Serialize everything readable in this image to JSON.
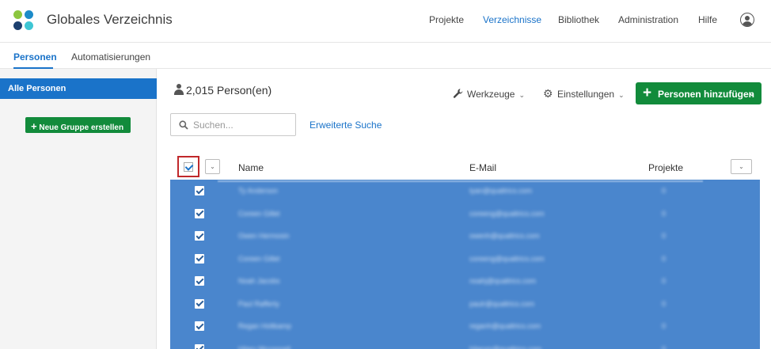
{
  "header": {
    "app_title": "Globales Verzeichnis",
    "nav": [
      {
        "label": "Projekte",
        "active": false
      },
      {
        "label": "Verzeichnisse",
        "active": true
      },
      {
        "label": "Bibliothek",
        "active": false
      },
      {
        "label": "Administration",
        "active": false
      },
      {
        "label": "Hilfe",
        "active": false
      }
    ],
    "profile_icon": "user-circle-icon"
  },
  "subnav": {
    "tabs": [
      {
        "label": "Personen",
        "active": true
      },
      {
        "label": "Automatisierungen",
        "active": false
      }
    ]
  },
  "sidebar": {
    "items": [
      {
        "label": "Alle Personen",
        "active": true
      }
    ],
    "new_group_button": "Neue Gruppe erstellen"
  },
  "main": {
    "count_label": "2,015 Person(en)",
    "tools_label": "Werkzeuge",
    "settings_label": "Einstellungen",
    "add_button_label": "Personen hinzufügen",
    "search": {
      "placeholder": "Suchen...",
      "value": ""
    },
    "advanced_search_label": "Erweiterte Suche"
  },
  "table": {
    "columns": [
      "Name",
      "E-Mail",
      "Projekte"
    ],
    "header_checked": true,
    "rows": [
      {
        "name": "Ty Anderson",
        "email": "tyan@qualtrics.com",
        "projects": "0",
        "checked": true
      },
      {
        "name": "Coreen Gillet",
        "email": "coreeng@qualtrics.com",
        "projects": "0",
        "checked": true
      },
      {
        "name": "Owen Hermosin",
        "email": "owenh@qualtrics.com",
        "projects": "0",
        "checked": true
      },
      {
        "name": "Coreen Gillet",
        "email": "coreeng@qualtrics.com",
        "projects": "0",
        "checked": true
      },
      {
        "name": "Noah Jacobs",
        "email": "noahj@qualtrics.com",
        "projects": "0",
        "checked": true
      },
      {
        "name": "Paul Rafferty",
        "email": "paulr@qualtrics.com",
        "projects": "0",
        "checked": true
      },
      {
        "name": "Regan Holtkamp",
        "email": "reganh@qualtrics.com",
        "projects": "0",
        "checked": true
      },
      {
        "name": "Hilary Mcconnell",
        "email": "hilarym@qualtrics.com",
        "projects": "0",
        "checked": true
      }
    ]
  },
  "colors": {
    "accent": "#1a73c9",
    "primary_button": "#128b3b",
    "selected_row": "#4a86cd",
    "highlight_border": "#c0282b"
  }
}
